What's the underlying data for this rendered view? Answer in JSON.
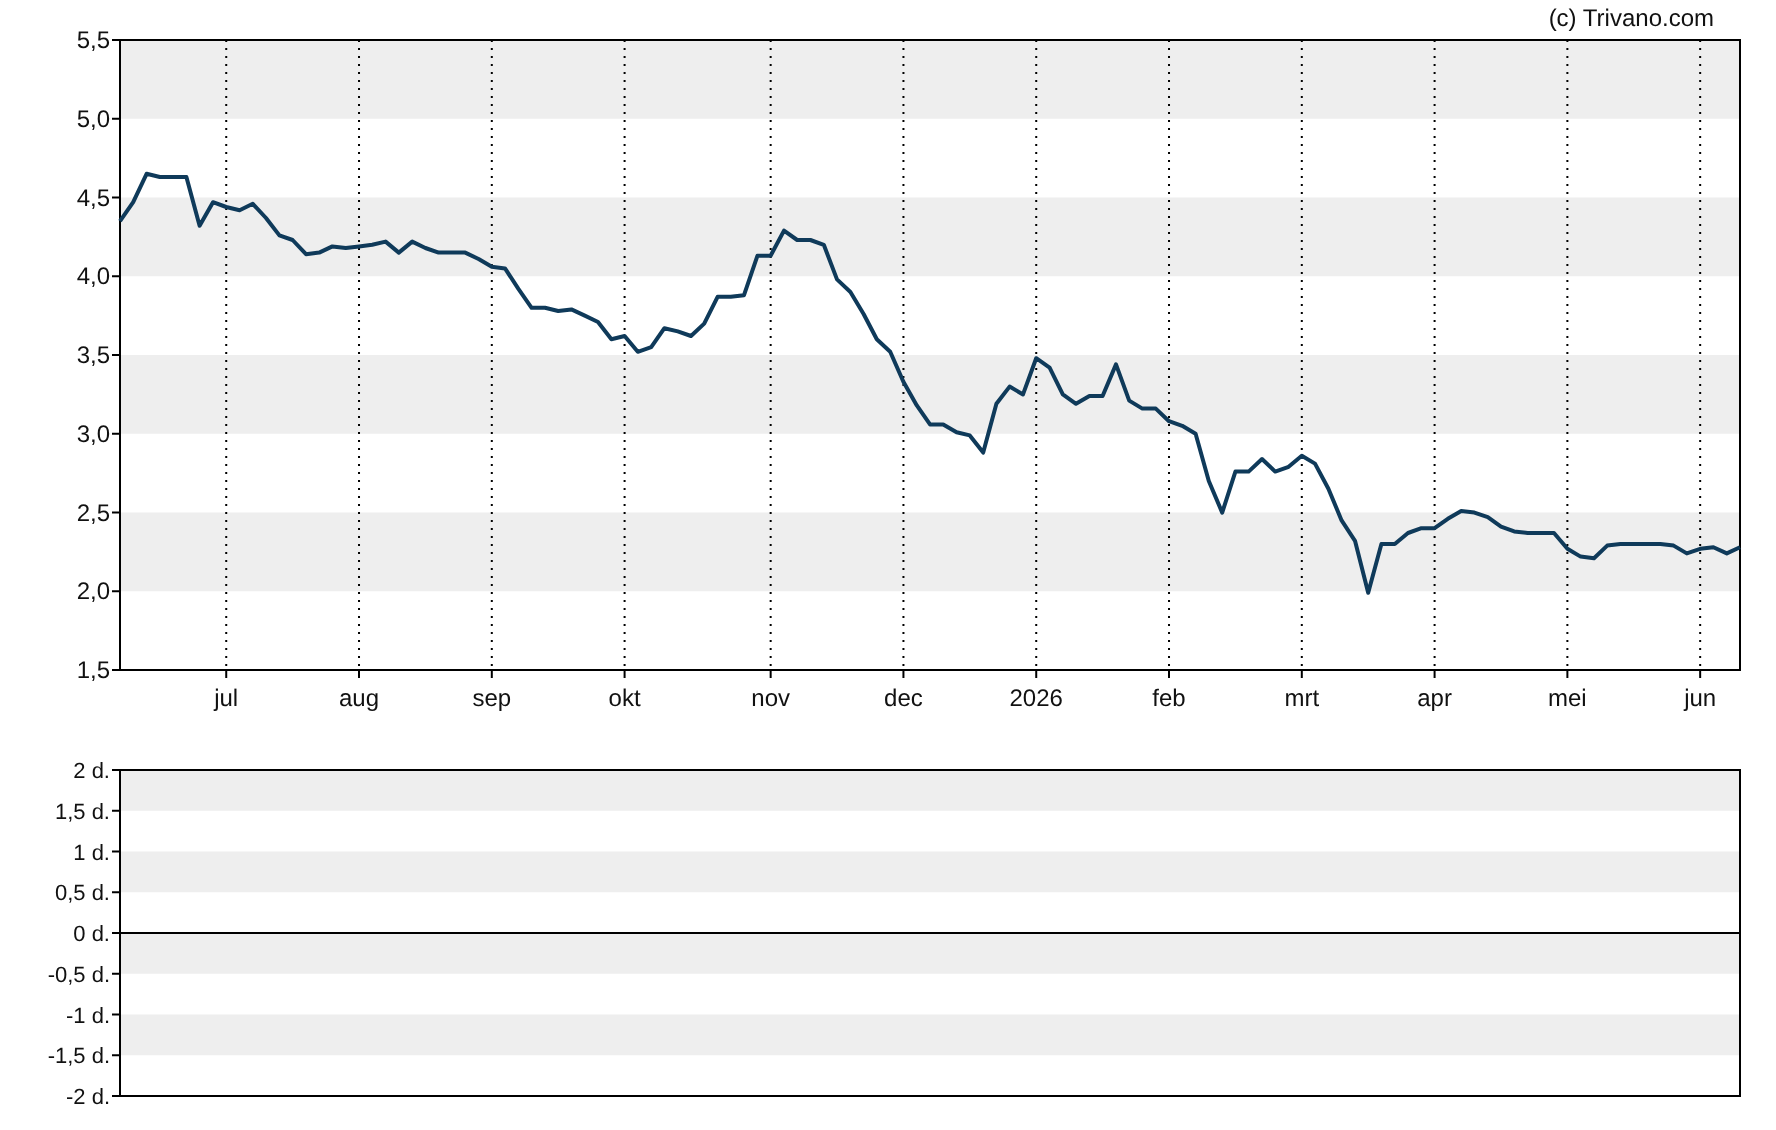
{
  "copyright": "(c) Trivano.com",
  "price_chart": {
    "chart_data": {
      "type": "line",
      "grid": true,
      "ylim": [
        1.5,
        5.5
      ],
      "categories": [
        null,
        null,
        null,
        null,
        null,
        null,
        null,
        null,
        "jul",
        null,
        null,
        null,
        null,
        null,
        null,
        null,
        null,
        null,
        "aug",
        null,
        null,
        null,
        null,
        null,
        null,
        null,
        null,
        null,
        "sep",
        null,
        null,
        null,
        null,
        null,
        null,
        null,
        null,
        null,
        "okt",
        null,
        null,
        null,
        null,
        null,
        null,
        null,
        null,
        null,
        null,
        "nov",
        null,
        null,
        null,
        null,
        null,
        null,
        null,
        null,
        null,
        "dec",
        null,
        null,
        null,
        null,
        null,
        null,
        null,
        null,
        null,
        "2026",
        null,
        null,
        null,
        null,
        null,
        null,
        null,
        null,
        null,
        "feb",
        null,
        null,
        null,
        null,
        null,
        null,
        null,
        null,
        null,
        "mrt",
        null,
        null,
        null,
        null,
        null,
        null,
        null,
        null,
        null,
        "apr",
        null,
        null,
        null,
        null,
        null,
        null,
        null,
        null,
        null,
        "mei",
        null,
        null,
        null,
        null,
        null,
        null,
        null,
        null,
        null,
        "jun",
        null,
        null,
        null
      ],
      "yticks": [
        {
          "value": 1.5,
          "label": "1,5"
        },
        {
          "value": 2,
          "label": "2,0"
        },
        {
          "value": 2.5,
          "label": "2,5"
        },
        {
          "value": 3,
          "label": "3,0"
        },
        {
          "value": 3.5,
          "label": "3,5"
        },
        {
          "value": 4,
          "label": "4,0"
        },
        {
          "value": 4.5,
          "label": "4,5"
        },
        {
          "value": 5,
          "label": "5,0"
        },
        {
          "value": 5.5,
          "label": "5,5"
        }
      ],
      "series": [
        {
          "color": "#0f3a5a",
          "values": [
            4.35,
            4.47,
            4.65,
            4.63,
            4.63,
            4.63,
            4.32,
            4.47,
            4.44,
            4.42,
            4.46,
            4.37,
            4.26,
            4.23,
            4.14,
            4.15,
            4.19,
            4.18,
            4.19,
            4.2,
            4.22,
            4.15,
            4.22,
            4.18,
            4.15,
            4.15,
            4.15,
            4.11,
            4.06,
            4.05,
            3.92,
            3.8,
            3.8,
            3.78,
            3.79,
            3.75,
            3.71,
            3.6,
            3.62,
            3.52,
            3.55,
            3.67,
            3.65,
            3.62,
            3.7,
            3.87,
            3.87,
            3.88,
            4.13,
            4.13,
            4.29,
            4.23,
            4.23,
            4.2,
            3.98,
            3.9,
            3.76,
            3.6,
            3.52,
            3.33,
            3.18,
            3.06,
            3.06,
            3.01,
            2.99,
            2.88,
            3.19,
            3.3,
            3.25,
            3.48,
            3.42,
            3.25,
            3.19,
            3.24,
            3.24,
            3.44,
            3.21,
            3.16,
            3.16,
            3.08,
            3.05,
            3.0,
            2.7,
            2.5,
            2.76,
            2.76,
            2.84,
            2.76,
            2.79,
            2.86,
            2.81,
            2.65,
            2.45,
            2.32,
            1.99,
            2.3,
            2.3,
            2.37,
            2.4,
            2.4,
            2.46,
            2.51,
            2.5,
            2.47,
            2.41,
            2.38,
            2.37,
            2.37,
            2.37,
            2.27,
            2.22,
            2.21,
            2.29,
            2.3,
            2.3,
            2.3,
            2.3,
            2.29,
            2.24,
            2.27,
            2.28,
            2.24,
            2.28
          ]
        }
      ]
    }
  },
  "lower_chart": {
    "chart_data": {
      "type": "line",
      "grid": true,
      "categories": [
        null,
        null
      ],
      "ylim": [
        -2,
        2
      ],
      "yticks": [
        {
          "value": -2,
          "label": "-2 d."
        },
        {
          "value": -1.5,
          "label": "-1,5 d."
        },
        {
          "value": -1,
          "label": "-1 d."
        },
        {
          "value": -0.5,
          "label": "-0,5 d."
        },
        {
          "value": 0,
          "label": "0 d."
        },
        {
          "value": 0.5,
          "label": "0,5 d."
        },
        {
          "value": 1,
          "label": "1 d."
        },
        {
          "value": 1.5,
          "label": "1,5 d."
        },
        {
          "value": 2,
          "label": "2 d."
        }
      ]
    }
  }
}
